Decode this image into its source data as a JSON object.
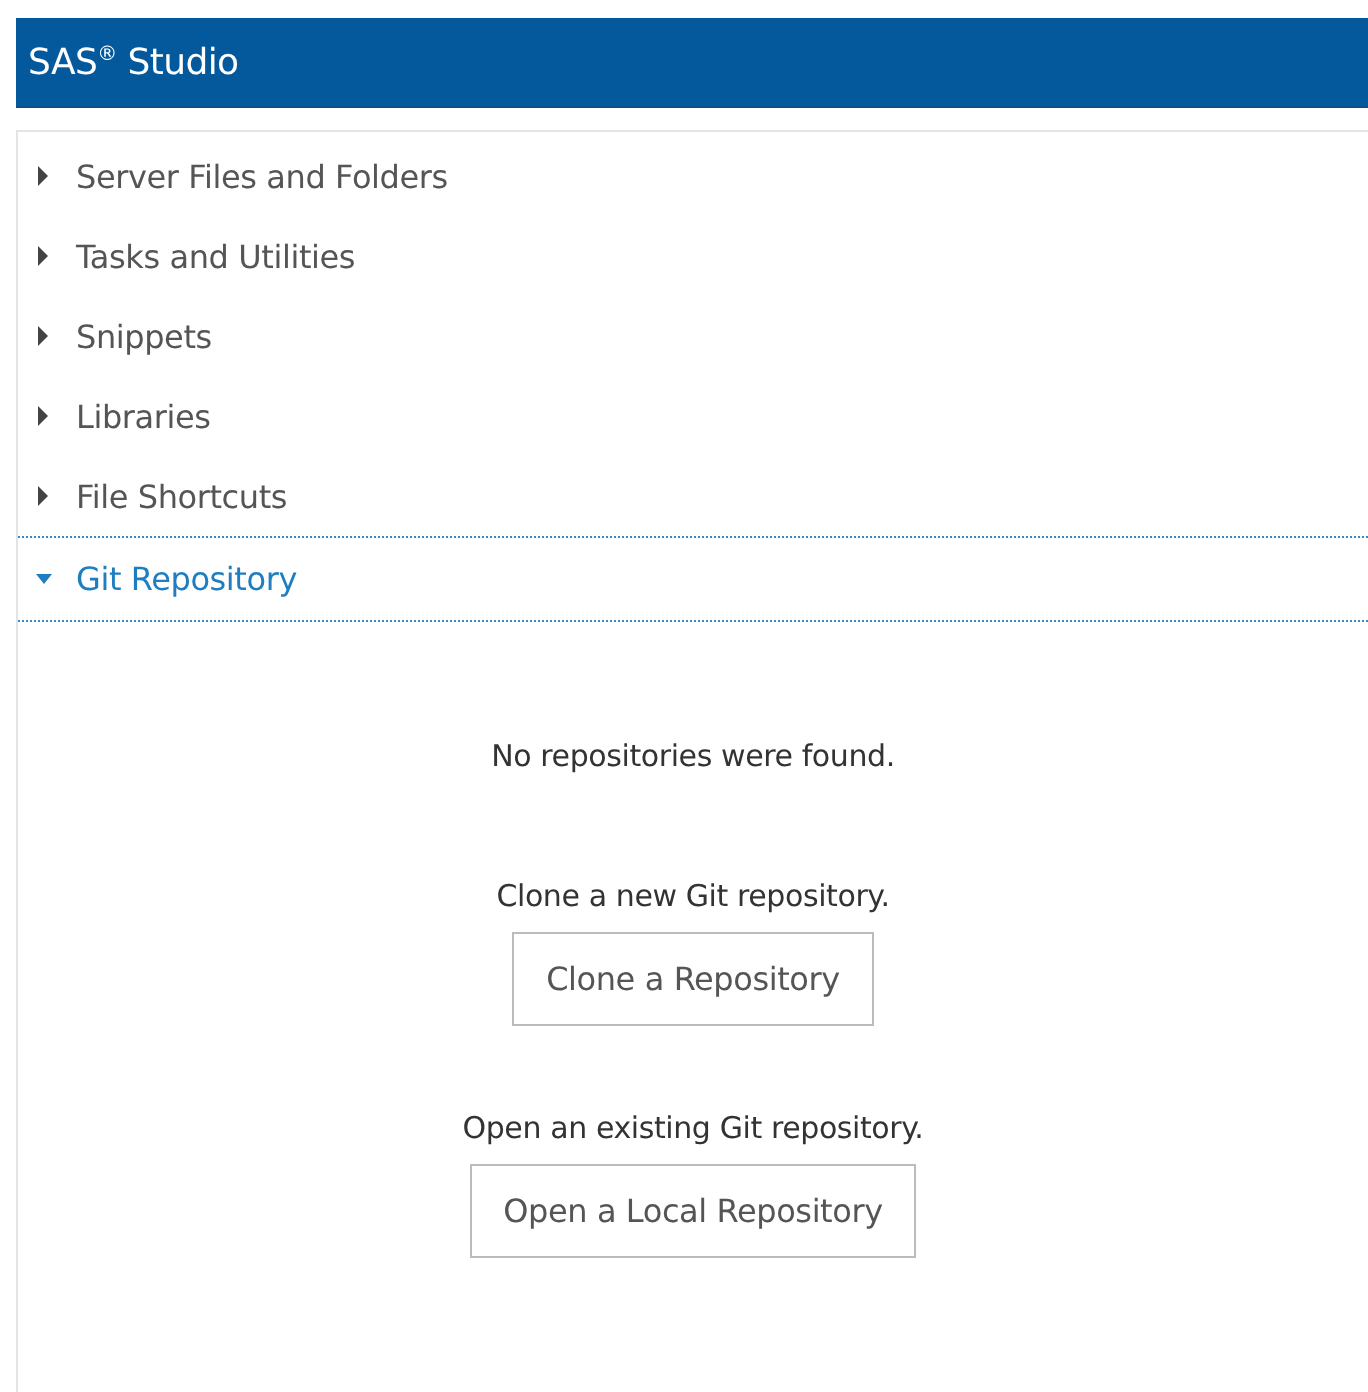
{
  "header": {
    "title": "SAS$^{®}$ Studio"
  },
  "sections": [
    {
      "label": "Server Files and Folders",
      "expanded": false
    },
    {
      "label": "Tasks and Utilities",
      "expanded": false
    },
    {
      "label": "Snippets",
      "expanded": false
    },
    {
      "label": "Libraries",
      "expanded": false
    },
    {
      "label": "File Shortcuts",
      "expanded": false
    },
    {
      "label": "Git Repository",
      "expanded": true
    }
  ],
  "git_panel": {
    "message": "No repositories were found.",
    "actions": [
      {
        "prompt": "Clone a new Git repository.",
        "button": "Clone a Repository"
      },
      {
        "prompt": "Open an existing Git repository.",
        "button": "Open a Local Repository"
      }
    ]
  }
}
